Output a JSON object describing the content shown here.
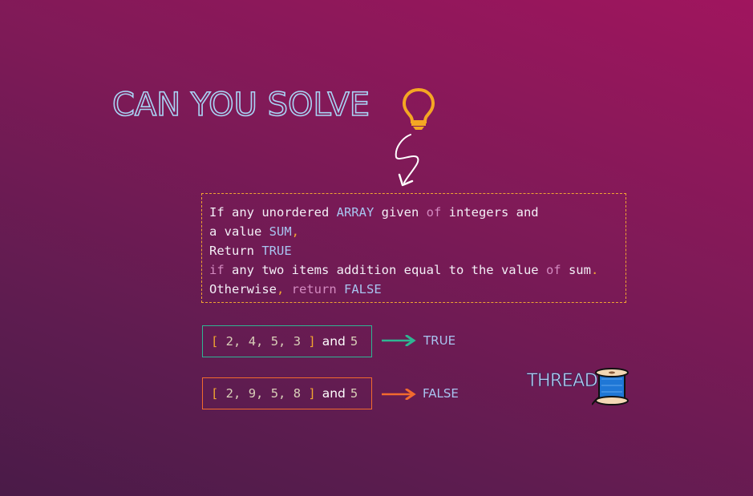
{
  "title": "CAN YOU SOLVE",
  "icons": {
    "title_icon": "lightbulb-icon",
    "pointer": "squiggle-arrow-icon",
    "thread_icon": "spool-of-thread-icon"
  },
  "problem": {
    "lines": [
      [
        {
          "t": "If any unordered ",
          "c": ""
        },
        {
          "t": "ARRAY",
          "c": "kw"
        },
        {
          "t": " given ",
          "c": ""
        },
        {
          "t": "of",
          "c": "kp"
        },
        {
          "t": " integers and",
          "c": ""
        }
      ],
      [
        {
          "t": "a value ",
          "c": ""
        },
        {
          "t": "SUM",
          "c": "kw"
        },
        {
          "t": ",",
          "c": "pu"
        }
      ],
      [
        {
          "t": "Return ",
          "c": ""
        },
        {
          "t": "TRUE",
          "c": "kw"
        }
      ],
      [
        {
          "t": "if",
          "c": "kp"
        },
        {
          "t": " any two items addition equal to the value ",
          "c": ""
        },
        {
          "t": "of",
          "c": "kp"
        },
        {
          "t": " sum",
          "c": ""
        },
        {
          "t": ".",
          "c": "pu"
        }
      ],
      [
        {
          "t": "Otherwise",
          "c": ""
        },
        {
          "t": ",",
          "c": "pu"
        },
        {
          "t": " return",
          "c": "kp"
        },
        {
          "t": " FALSE",
          "c": "kw"
        }
      ]
    ]
  },
  "examples": [
    {
      "array": [
        "2",
        "4",
        "5",
        "3"
      ],
      "and_label": "and",
      "sum": "5",
      "result": "TRUE",
      "color": "#2fb593"
    },
    {
      "array": [
        "2",
        "9",
        "5",
        "8"
      ],
      "and_label": "and",
      "sum": "5",
      "result": "FALSE",
      "color": "#f26a2e"
    }
  ],
  "thread_label": "THREAD",
  "colors": {
    "keyword": "#a8c4f0",
    "keyword_pink": "#d38ac0",
    "punctuation": "#f2a531",
    "bulb": "#f5a623",
    "true_border": "#2fb593",
    "false_border": "#f26a2e",
    "title_outline": "#a9d4f5"
  }
}
